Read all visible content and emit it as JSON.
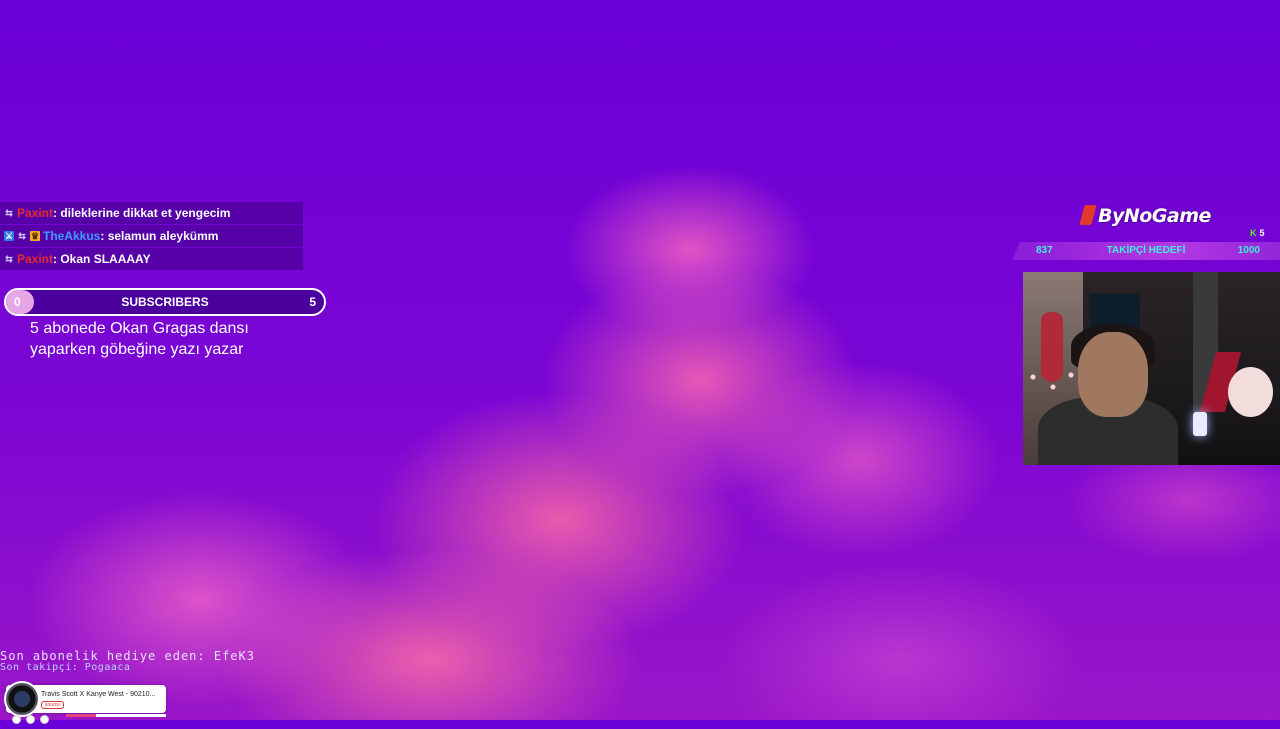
{
  "chat": {
    "messages": [
      {
        "username": "Paxint",
        "text": ": dileklerine dikkat et yengecim"
      },
      {
        "username": "TheAkkus",
        "text": ": selamun aleykümm"
      },
      {
        "username": "Paxint",
        "text": ": Okan SLAAAAY"
      }
    ]
  },
  "subscribers": {
    "label": "SUBSCRIBERS",
    "current": "0",
    "target": "5",
    "progress_fraction": 0.0,
    "goal_text": "5 abonede Okan Gragas dansı yaparken göbeğine yazı yazar"
  },
  "last_gift": "Son abonelik hediye eden: EfeK3",
  "last_follower": "Son takipçi: Pogaaca",
  "music": {
    "track": "Travis Scott X Kanye West - 90210...",
    "tag": "source"
  },
  "sponsor": {
    "name": "ByNoGame"
  },
  "kick": {
    "icon": "kick-logo-icon",
    "count": "5"
  },
  "follow_goal": {
    "current": "837",
    "label": "TAKİPÇİ HEDEFİ",
    "target": "1000"
  },
  "colors": {
    "background": "#6a00d8",
    "accent_pink": "#ee5fb0",
    "goal_text": "#3ff0d9"
  }
}
